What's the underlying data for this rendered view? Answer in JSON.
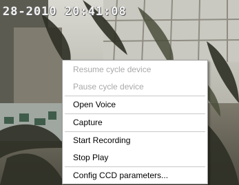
{
  "overlay": {
    "timestamp": "28-2010 20:41:08"
  },
  "context_menu": {
    "items": [
      {
        "label": "Resume cycle device",
        "enabled": false
      },
      {
        "label": "Pause cycle device",
        "enabled": false
      },
      {
        "label": "Open Voice",
        "enabled": true
      },
      {
        "label": "Capture",
        "enabled": true
      },
      {
        "label": "Start Recording",
        "enabled": true
      },
      {
        "label": "Stop Play",
        "enabled": true
      },
      {
        "label": "Config CCD parameters...",
        "enabled": true
      }
    ]
  }
}
